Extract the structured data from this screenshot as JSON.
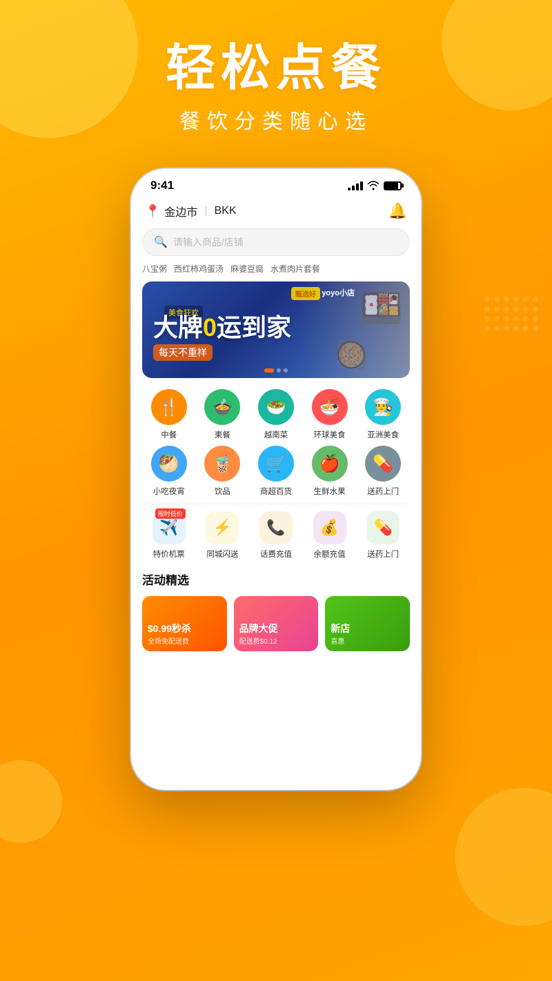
{
  "background": {
    "gradient_start": "#FFB800",
    "gradient_end": "#FF9500"
  },
  "hero": {
    "title": "轻松点餐",
    "subtitle": "餐饮分类随心选"
  },
  "phone": {
    "status_bar": {
      "time": "9:41"
    },
    "location": {
      "city": "金边市",
      "code": "BKK"
    },
    "search": {
      "placeholder": "请输入商品/店铺"
    },
    "tags": [
      "八宝粥",
      "西红柿鸡蛋汤",
      "麻婆豆腐",
      "水煮肉片套餐"
    ],
    "banner": {
      "label": "美食狂欢",
      "main_text": "大牌0运到家",
      "sub_text": "每天不重样",
      "highlight_char": "0"
    },
    "categories": [
      {
        "icon": "🍴",
        "label": "中餐",
        "bg": "#FF8C00"
      },
      {
        "icon": "🍲",
        "label": "柬餐",
        "bg": "#2DBD70"
      },
      {
        "icon": "🥗",
        "label": "越南菜",
        "bg": "#1AB8A0"
      },
      {
        "icon": "🍜",
        "label": "环球美食",
        "bg": "#FF5252"
      },
      {
        "icon": "👨‍🍳",
        "label": "亚洲美食",
        "bg": "#26C6DA"
      }
    ],
    "subcategories": [
      {
        "icon": "🥙",
        "label": "小吃夜宵",
        "bg": "#42A5F5"
      },
      {
        "icon": "🧋",
        "label": "饮品",
        "bg": "#FF8C42"
      },
      {
        "icon": "🛒",
        "label": "商超百货",
        "bg": "#29B6F6"
      },
      {
        "icon": "🍎",
        "label": "生鲜水果",
        "bg": "#66BB6A"
      },
      {
        "icon": "💊",
        "label": "送药上门",
        "bg": "#78909C"
      }
    ],
    "services": [
      {
        "icon": "✈️",
        "label": "特价机票",
        "bg": "#E3F2FD",
        "badge": "限时低价"
      },
      {
        "icon": "⚡",
        "label": "同城闪送",
        "bg": "#FFF8E1"
      },
      {
        "icon": "📞",
        "label": "话费充值",
        "bg": "#FFF3E0"
      },
      {
        "icon": "💰",
        "label": "余额充值",
        "bg": "#F3E5F5"
      },
      {
        "icon": "💊",
        "label": "送药上门",
        "bg": "#E8F5E9"
      }
    ],
    "activity_section": {
      "title": "活动精选",
      "cards": [
        {
          "title": "$0.99秒杀",
          "subtitle": "全场免配送费",
          "tag": "",
          "color": "orange"
        },
        {
          "title": "品牌大促",
          "subtitle": "配送费$0.12",
          "tag": "",
          "color": "red"
        },
        {
          "title": "新店",
          "subtitle": "喜惠",
          "tag": "",
          "color": "green"
        }
      ]
    }
  }
}
